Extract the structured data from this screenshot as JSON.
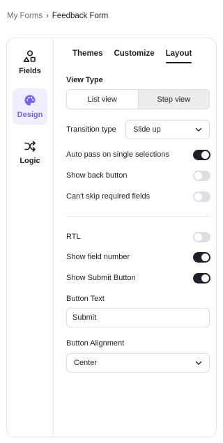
{
  "breadcrumb": {
    "root": "My Forms",
    "separator": "›",
    "current": "Feedback Form"
  },
  "sidebar": {
    "items": [
      {
        "label": "Fields",
        "icon": "shapes-icon",
        "active": false
      },
      {
        "label": "Design",
        "icon": "palette-icon",
        "active": true
      },
      {
        "label": "Logic",
        "icon": "shuffle-icon",
        "active": false
      }
    ]
  },
  "tabs": [
    {
      "label": "Themes",
      "active": false
    },
    {
      "label": "Customize",
      "active": false
    },
    {
      "label": "Layout",
      "active": true
    }
  ],
  "layout": {
    "view_type": {
      "label": "View Type",
      "options": [
        "List view",
        "Step view"
      ],
      "selected": "Step view"
    },
    "transition": {
      "label": "Transition type",
      "value": "Slide up"
    },
    "toggles_top": [
      {
        "label": "Auto pass on single selections",
        "on": true
      },
      {
        "label": "Show back button",
        "on": false
      },
      {
        "label": "Can't skip required fields",
        "on": false
      }
    ],
    "toggles_bottom": [
      {
        "label": "RTL",
        "on": false
      },
      {
        "label": "Show field number",
        "on": true
      },
      {
        "label": "Show Submit Button",
        "on": true
      }
    ],
    "button_text": {
      "label": "Button Text",
      "value": "Submit"
    },
    "button_alignment": {
      "label": "Button Alignment",
      "value": "Center"
    }
  },
  "colors": {
    "accent": "#7b61e6",
    "toggle_on": "#1f1f2a",
    "toggle_off": "#dedee4"
  }
}
